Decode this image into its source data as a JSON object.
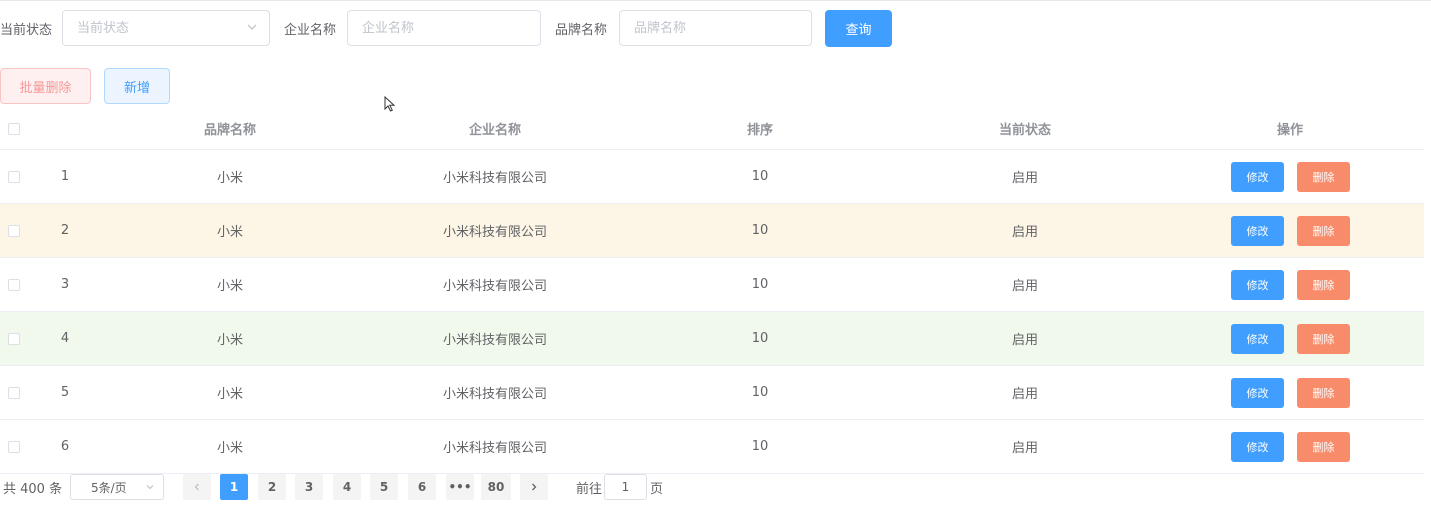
{
  "search": {
    "status_label": "当前状态",
    "status_placeholder": "当前状态",
    "company_label": "企业名称",
    "company_placeholder": "企业名称",
    "brand_label": "品牌名称",
    "brand_placeholder": "品牌名称",
    "query_label": "查询"
  },
  "actions": {
    "batch_delete_label": "批量删除",
    "add_label": "新增"
  },
  "table": {
    "headers": {
      "brand": "品牌名称",
      "company": "企业名称",
      "sort": "排序",
      "status": "当前状态",
      "ops": "操作"
    },
    "edit_label": "修改",
    "delete_label": "删除",
    "rows": [
      {
        "index": "1",
        "brand": "小米",
        "company": "小米科技有限公司",
        "sort": "10",
        "status": "启用"
      },
      {
        "index": "2",
        "brand": "小米",
        "company": "小米科技有限公司",
        "sort": "10",
        "status": "启用"
      },
      {
        "index": "3",
        "brand": "小米",
        "company": "小米科技有限公司",
        "sort": "10",
        "status": "启用"
      },
      {
        "index": "4",
        "brand": "小米",
        "company": "小米科技有限公司",
        "sort": "10",
        "status": "启用"
      },
      {
        "index": "5",
        "brand": "小米",
        "company": "小米科技有限公司",
        "sort": "10",
        "status": "启用"
      },
      {
        "index": "6",
        "brand": "小米",
        "company": "小米科技有限公司",
        "sort": "10",
        "status": "启用"
      }
    ]
  },
  "pagination": {
    "total_text": "共 400 条",
    "page_size": "5条/页",
    "pages": [
      "1",
      "2",
      "3",
      "4",
      "5",
      "6",
      "•••",
      "80"
    ],
    "current_page": "1",
    "goto_label": "前往",
    "goto_value": "1",
    "page_suffix": "页"
  },
  "colors": {
    "primary": "#409eff",
    "danger": "#f78b6a",
    "warning_row": "#fdf5e6",
    "success_row": "#f0f9eb"
  },
  "icons": {
    "select_arrow": "chevron-down-icon",
    "prev": "chevron-left-icon",
    "next": "chevron-right-icon",
    "cursor": "mouse-cursor-icon"
  }
}
